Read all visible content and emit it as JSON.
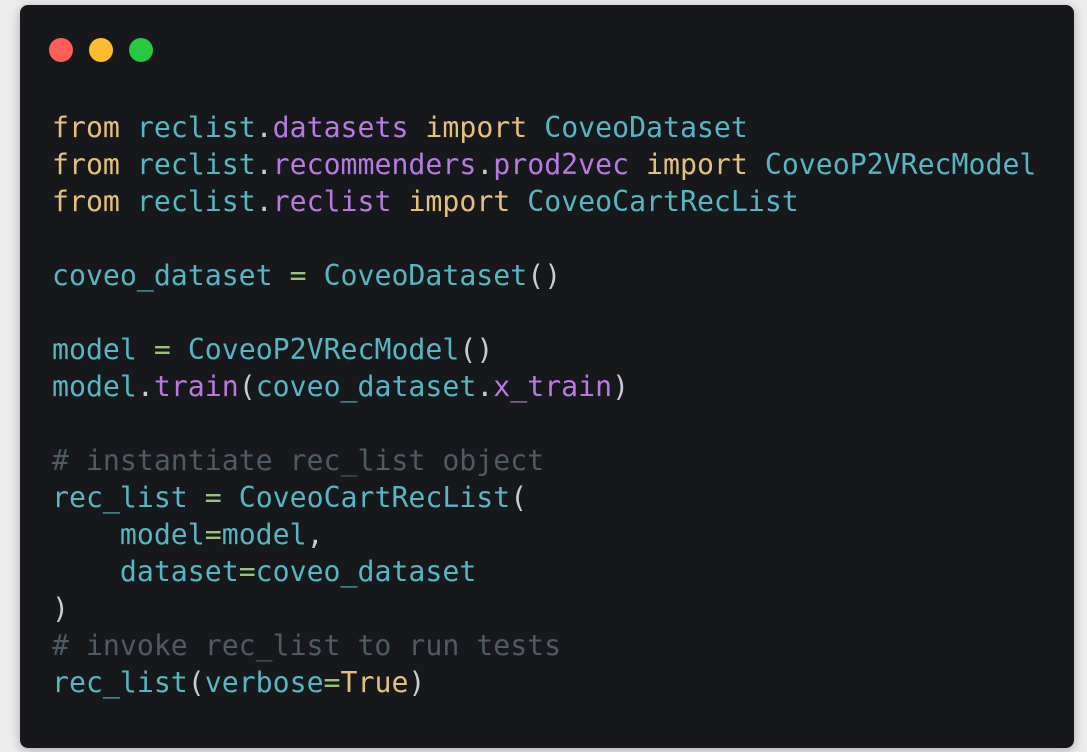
{
  "window": {
    "buttons": [
      {
        "name": "close-button",
        "color": "#ff5f56"
      },
      {
        "name": "minimize-button",
        "color": "#ffbd2e"
      },
      {
        "name": "maximize-button",
        "color": "#27c93f"
      }
    ]
  },
  "theme": {
    "background": "#16181b",
    "identifier": "#56b6c2",
    "keyword": "#e5c07b",
    "attribute": "#b77be0",
    "operator": "#98c379",
    "punctuation": "#c8ccd4",
    "comment": "#4f5a63"
  },
  "code": {
    "lines": [
      [
        [
          "kw",
          "from"
        ],
        [
          "pl",
          " "
        ],
        [
          "id",
          "reclist"
        ],
        [
          "pu",
          "."
        ],
        [
          "at",
          "datasets"
        ],
        [
          "pl",
          " "
        ],
        [
          "kw",
          "import"
        ],
        [
          "pl",
          " "
        ],
        [
          "id",
          "CoveoDataset"
        ]
      ],
      [
        [
          "kw",
          "from"
        ],
        [
          "pl",
          " "
        ],
        [
          "id",
          "reclist"
        ],
        [
          "pu",
          "."
        ],
        [
          "at",
          "recommenders"
        ],
        [
          "pu",
          "."
        ],
        [
          "at",
          "prod2vec"
        ],
        [
          "pl",
          " "
        ],
        [
          "kw",
          "import"
        ],
        [
          "pl",
          " "
        ],
        [
          "id",
          "CoveoP2VRecModel"
        ]
      ],
      [
        [
          "kw",
          "from"
        ],
        [
          "pl",
          " "
        ],
        [
          "id",
          "reclist"
        ],
        [
          "pu",
          "."
        ],
        [
          "at",
          "reclist"
        ],
        [
          "pl",
          " "
        ],
        [
          "kw",
          "import"
        ],
        [
          "pl",
          " "
        ],
        [
          "id",
          "CoveoCartRecList"
        ]
      ],
      [],
      [
        [
          "id",
          "coveo_dataset"
        ],
        [
          "pl",
          " "
        ],
        [
          "op",
          "="
        ],
        [
          "pl",
          " "
        ],
        [
          "id",
          "CoveoDataset"
        ],
        [
          "pu",
          "()"
        ]
      ],
      [],
      [
        [
          "id",
          "model"
        ],
        [
          "pl",
          " "
        ],
        [
          "op",
          "="
        ],
        [
          "pl",
          " "
        ],
        [
          "id",
          "CoveoP2VRecModel"
        ],
        [
          "pu",
          "()"
        ]
      ],
      [
        [
          "id",
          "model"
        ],
        [
          "pu",
          "."
        ],
        [
          "at",
          "train"
        ],
        [
          "pu",
          "("
        ],
        [
          "id",
          "coveo_dataset"
        ],
        [
          "pu",
          "."
        ],
        [
          "at",
          "x_train"
        ],
        [
          "pu",
          ")"
        ]
      ],
      [],
      [
        [
          "cm",
          "# instantiate rec_list object"
        ]
      ],
      [
        [
          "id",
          "rec_list"
        ],
        [
          "pl",
          " "
        ],
        [
          "op",
          "="
        ],
        [
          "pl",
          " "
        ],
        [
          "id",
          "CoveoCartRecList"
        ],
        [
          "pu",
          "("
        ]
      ],
      [
        [
          "pl",
          "    "
        ],
        [
          "id",
          "model"
        ],
        [
          "op",
          "="
        ],
        [
          "id",
          "model"
        ],
        [
          "pu",
          ","
        ]
      ],
      [
        [
          "pl",
          "    "
        ],
        [
          "id",
          "dataset"
        ],
        [
          "op",
          "="
        ],
        [
          "id",
          "coveo_dataset"
        ]
      ],
      [
        [
          "pu",
          ")"
        ]
      ],
      [
        [
          "cm",
          "# invoke rec_list to run tests"
        ]
      ],
      [
        [
          "id",
          "rec_list"
        ],
        [
          "pu",
          "("
        ],
        [
          "id",
          "verbose"
        ],
        [
          "op",
          "="
        ],
        [
          "kw",
          "True"
        ],
        [
          "pu",
          ")"
        ]
      ]
    ]
  }
}
